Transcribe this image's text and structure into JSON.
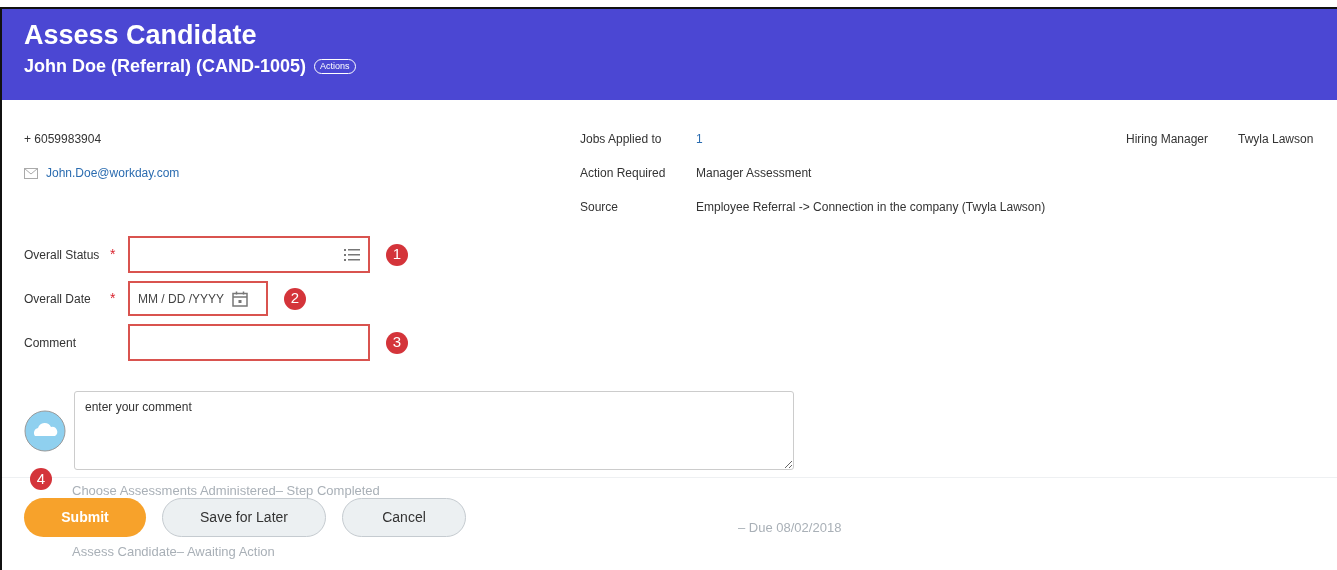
{
  "header": {
    "title": "Assess Candidate",
    "subtitle": "John Doe (Referral) (CAND-1005)",
    "actions_button": "Actions"
  },
  "contact": {
    "phone": "+ 6059983904",
    "email": "John.Doe@workday.com"
  },
  "details": [
    {
      "label": "Jobs Applied to",
      "value": "1",
      "kind": "link"
    },
    {
      "label": "Action Required",
      "value": "Manager Assessment",
      "kind": "text"
    },
    {
      "label": "Source",
      "value": "Employee Referral -> Connection in the company (Twyla Lawson)",
      "kind": "text"
    }
  ],
  "hiring_manager": {
    "label": "Hiring Manager",
    "value": "Twyla Lawson"
  },
  "form_fields": [
    {
      "label": "Overall Status",
      "required_mark": "*",
      "kind": "select",
      "callout": "1"
    },
    {
      "label": "Overall Date",
      "required_mark": "*",
      "kind": "date",
      "placeholder": "MM / DD /YYYY",
      "callout": "2"
    },
    {
      "label": "Comment",
      "kind": "text",
      "callout": "3"
    }
  ],
  "comment_box": {
    "placeholder": "enter your comment"
  },
  "background_steps": [
    {
      "text": "Choose Assessments Administered– Step Completed"
    },
    {
      "text": "– Due 08/02/2018"
    },
    {
      "text": "Assess Candidate– Awaiting Action"
    }
  ],
  "buttons_callout": "4",
  "buttons": [
    {
      "label": "Submit",
      "kind": "primary"
    },
    {
      "label": "Save for Later",
      "kind": "secondary"
    },
    {
      "label": "Cancel",
      "kind": "secondary"
    }
  ]
}
